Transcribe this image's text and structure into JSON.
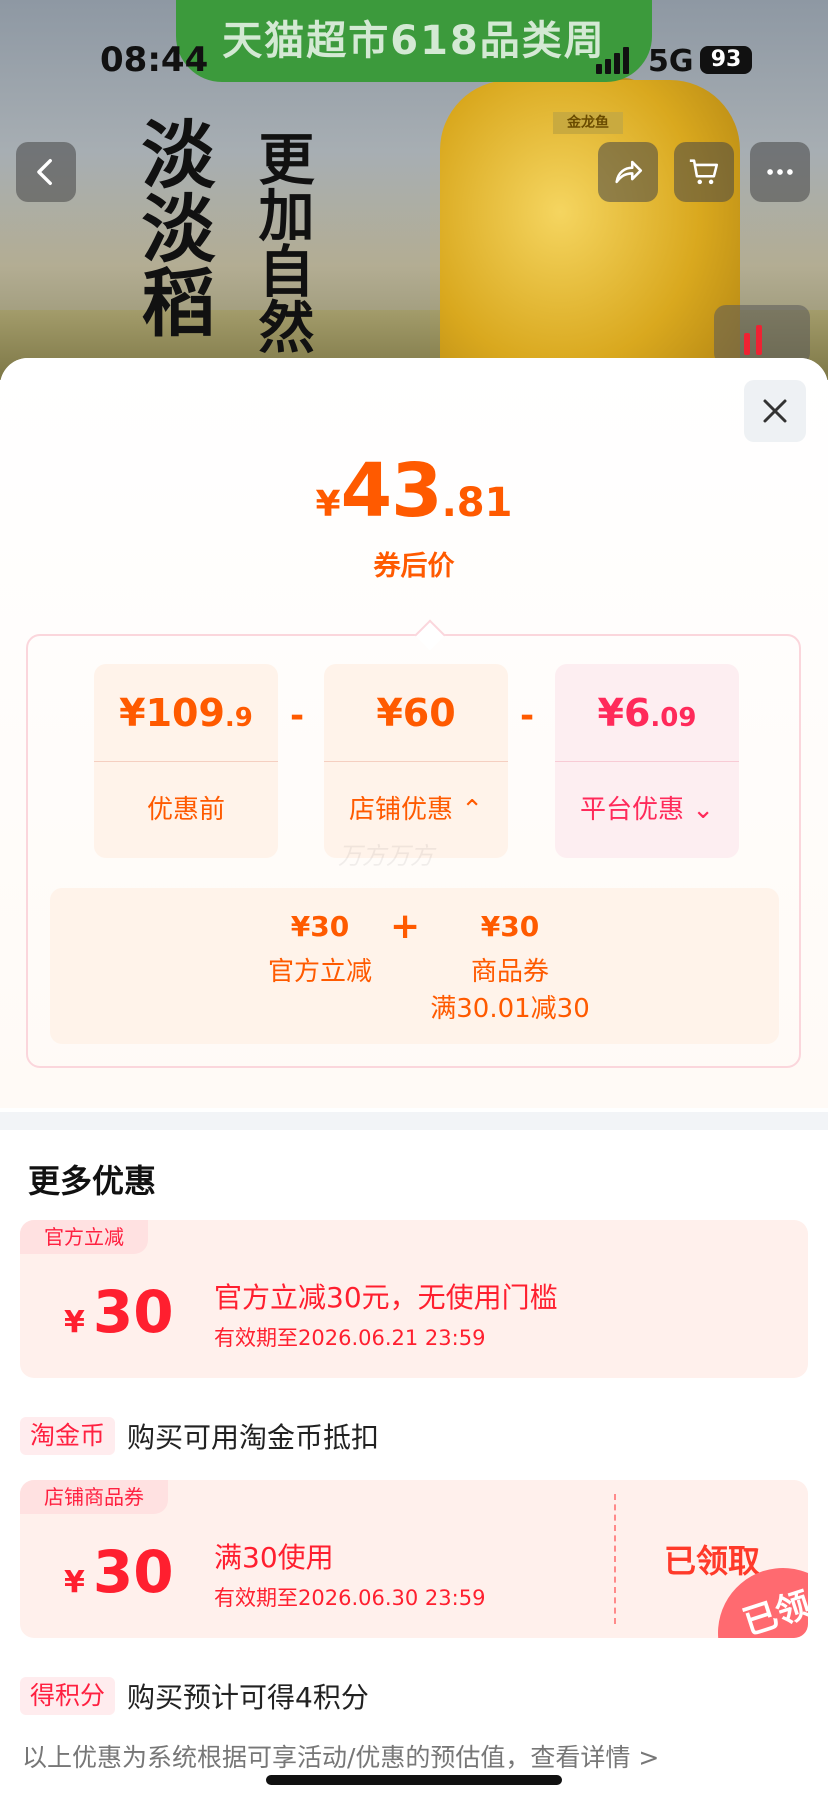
{
  "status_bar": {
    "time": "08:44",
    "network": "5G",
    "battery": "93"
  },
  "banner": {
    "text": "天猫超市618品类周"
  },
  "product_image": {
    "text_left": "淡淡稻",
    "text_right": "更加自然",
    "bottle_label": "金龙鱼"
  },
  "nav": {
    "back_icon": "chevron-left-icon",
    "share_icon": "share-icon",
    "cart_icon": "cart-icon",
    "more_icon": "more-icon"
  },
  "sheet": {
    "close_icon": "close-icon",
    "price": {
      "symbol": "¥",
      "integer": "43",
      "decimal": ".81",
      "label": "券后价"
    },
    "breakdown": {
      "original": {
        "value_main": "¥109",
        "value_small": ".9",
        "label": "优惠前"
      },
      "minus1": "-",
      "store": {
        "value_main": "¥60",
        "value_small": "",
        "label": "店铺优惠 ⌃"
      },
      "minus2": "-",
      "platform": {
        "value_main": "¥6",
        "value_small": ".09",
        "label": "平台优惠 ⌄"
      },
      "watermark": "万方万方"
    },
    "store_detail": {
      "item1": {
        "amount": "¥30",
        "label": "官方立减"
      },
      "plus": "+",
      "item2": {
        "amount": "¥30",
        "label": "商品券",
        "condition": "满30.01减30"
      }
    },
    "more": {
      "title": "更多优惠",
      "coupon1": {
        "tag": "官方立减",
        "yen": "¥",
        "amount": "30",
        "title": "官方立减30元，无使用门槛",
        "validity": "有效期至2026.06.21 23:59"
      },
      "coins": {
        "chip": "淘金币",
        "text": "购买可用淘金币抵扣"
      },
      "coupon2": {
        "tag": "店铺商品券",
        "yen": "¥",
        "amount": "30",
        "title": "满30使用",
        "validity": "有效期至2026.06.30 23:59",
        "status": "已领取",
        "stamp": "已领"
      },
      "points": {
        "chip": "得积分",
        "text": "购买预计可得4积分"
      }
    },
    "footnote": "以上优惠为系统根据可享活动/优惠的预估值，查看详情 >"
  }
}
